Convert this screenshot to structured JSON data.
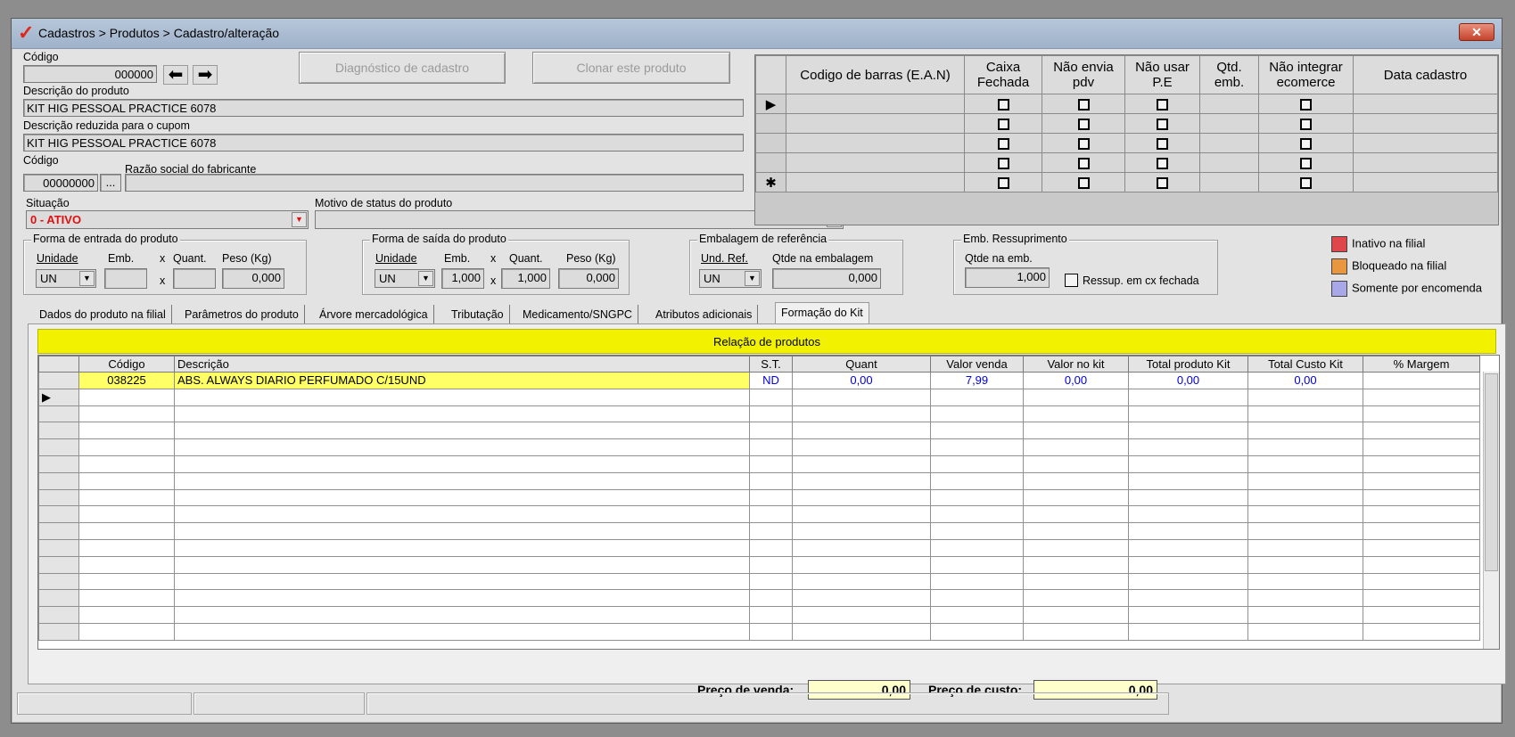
{
  "window": {
    "title": "Cadastros > Produtos > Cadastro/alteração",
    "close_glyph": "✕"
  },
  "product": {
    "codigo_label": "Código",
    "codigo_value": "000000",
    "descricao_label": "Descrição  do produto",
    "descricao_value": "KIT HIG PESSOAL PRACTICE 6078",
    "desc_reduzida_label": "Descrição reduzida para o cupom",
    "desc_reduzida_value": "KIT HIG PESSOAL PRACTICE 6078",
    "fab_codigo_label": "Código",
    "fab_codigo_value": "00000000",
    "fab_lookup": "...",
    "razao_label": "Razão social do fabricante",
    "razao_value": "",
    "situacao_label": "Situação",
    "situacao_value": "0 - ATIVO",
    "motivo_label": "Motivo de status do produto",
    "motivo_value": ""
  },
  "buttons": {
    "diagnostico": "Diagnóstico de cadastro",
    "clonar": "Clonar este produto"
  },
  "barcodes": {
    "headers": [
      "Codigo de barras (E.A.N)",
      "Caixa Fechada",
      "Não envia pdv",
      "Não usar P.E",
      "Qtd. emb.",
      "Não integrar ecomerce",
      "Data cadastro"
    ],
    "row_indicator_current": "▶",
    "row_indicator_new": "✱"
  },
  "entrada": {
    "title": "Forma de entrada do produto",
    "unidade_label": "Unidade",
    "emb_label": "Emb.",
    "x1": "x",
    "quant_label": "Quant.",
    "peso_label": "Peso (Kg)",
    "unidade_value": "UN",
    "emb_value": "",
    "x2": "x",
    "quant_value": "",
    "peso_value": "0,000"
  },
  "saida": {
    "title": "Forma de saída do produto",
    "unidade_label": "Unidade",
    "emb_label": "Emb.",
    "x1": "x",
    "quant_label": "Quant.",
    "peso_label": "Peso (Kg)",
    "unidade_value": "UN",
    "emb_value": "1,000",
    "x2": "x",
    "quant_value": "1,000",
    "peso_value": "0,000"
  },
  "embalagem_ref": {
    "title": "Embalagem de referência",
    "und_label": "Und. Ref.",
    "qtde_label": "Qtde na embalagem",
    "und_value": "UN",
    "qtde_value": "0,000"
  },
  "ressuprimento": {
    "title": "Emb. Ressuprimento",
    "qtde_label": "Qtde na emb.",
    "qtde_value": "1,000",
    "checkbox_label": "Ressup. em cx fechada"
  },
  "legend": [
    {
      "label": "Inativo na filial",
      "color": "#e0474a"
    },
    {
      "label": "Bloqueado na filial",
      "color": "#e8973f"
    },
    {
      "label": "Somente por encomenda",
      "color": "#a8a8e8"
    }
  ],
  "tabs": [
    "Dados do produto na filial",
    "Parâmetros do produto",
    "Árvore mercadológica",
    "Tributação",
    "Medicamento/SNGPC",
    "Atributos adicionais",
    "Formação do Kit"
  ],
  "kit": {
    "bar_title": "Relação de produtos",
    "headers": [
      "Código",
      "Descrição",
      "S.T.",
      "Quant",
      "Valor venda",
      "Valor no kit",
      "Total produto Kit",
      "Total Custo Kit",
      "% Margem"
    ],
    "rows": [
      {
        "codigo": "038225",
        "descricao": "ABS. ALWAYS DIARIO PERFUMADO C/15UND",
        "st": "ND",
        "quant": "0,00",
        "valor_venda": "7,99",
        "valor_kit": "0,00",
        "total_prod": "0,00",
        "total_custo": "0,00",
        "margem": ""
      }
    ],
    "current_row_indicator": "▶"
  },
  "totals": {
    "preco_venda_label": "Preço de venda:",
    "preco_venda_value": "0,00",
    "preco_custo_label": "Preço de custo:",
    "preco_custo_value": "0,00"
  }
}
